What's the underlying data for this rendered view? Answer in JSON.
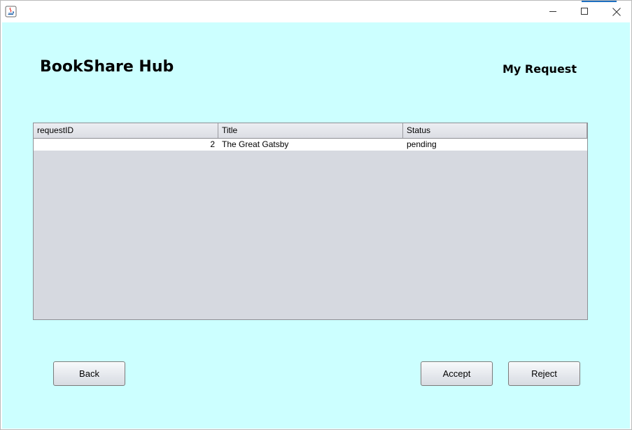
{
  "window": {
    "app_icon": "java-icon",
    "controls": {
      "minimize": "minimize-icon",
      "maximize": "maximize-icon",
      "close": "close-icon"
    },
    "accent_color": "#1e6fc0"
  },
  "header": {
    "app_title": "BookShare Hub",
    "page_title": "My Request"
  },
  "table": {
    "columns": [
      "requestID",
      "Title",
      "Status"
    ],
    "rows": [
      {
        "requestID": "2",
        "title": "The Great Gatsby",
        "status": "pending"
      }
    ]
  },
  "buttons": {
    "back": "Back",
    "accept": "Accept",
    "reject": "Reject"
  },
  "colors": {
    "background": "#ccffff",
    "table_empty_area": "#d6d9e0"
  }
}
